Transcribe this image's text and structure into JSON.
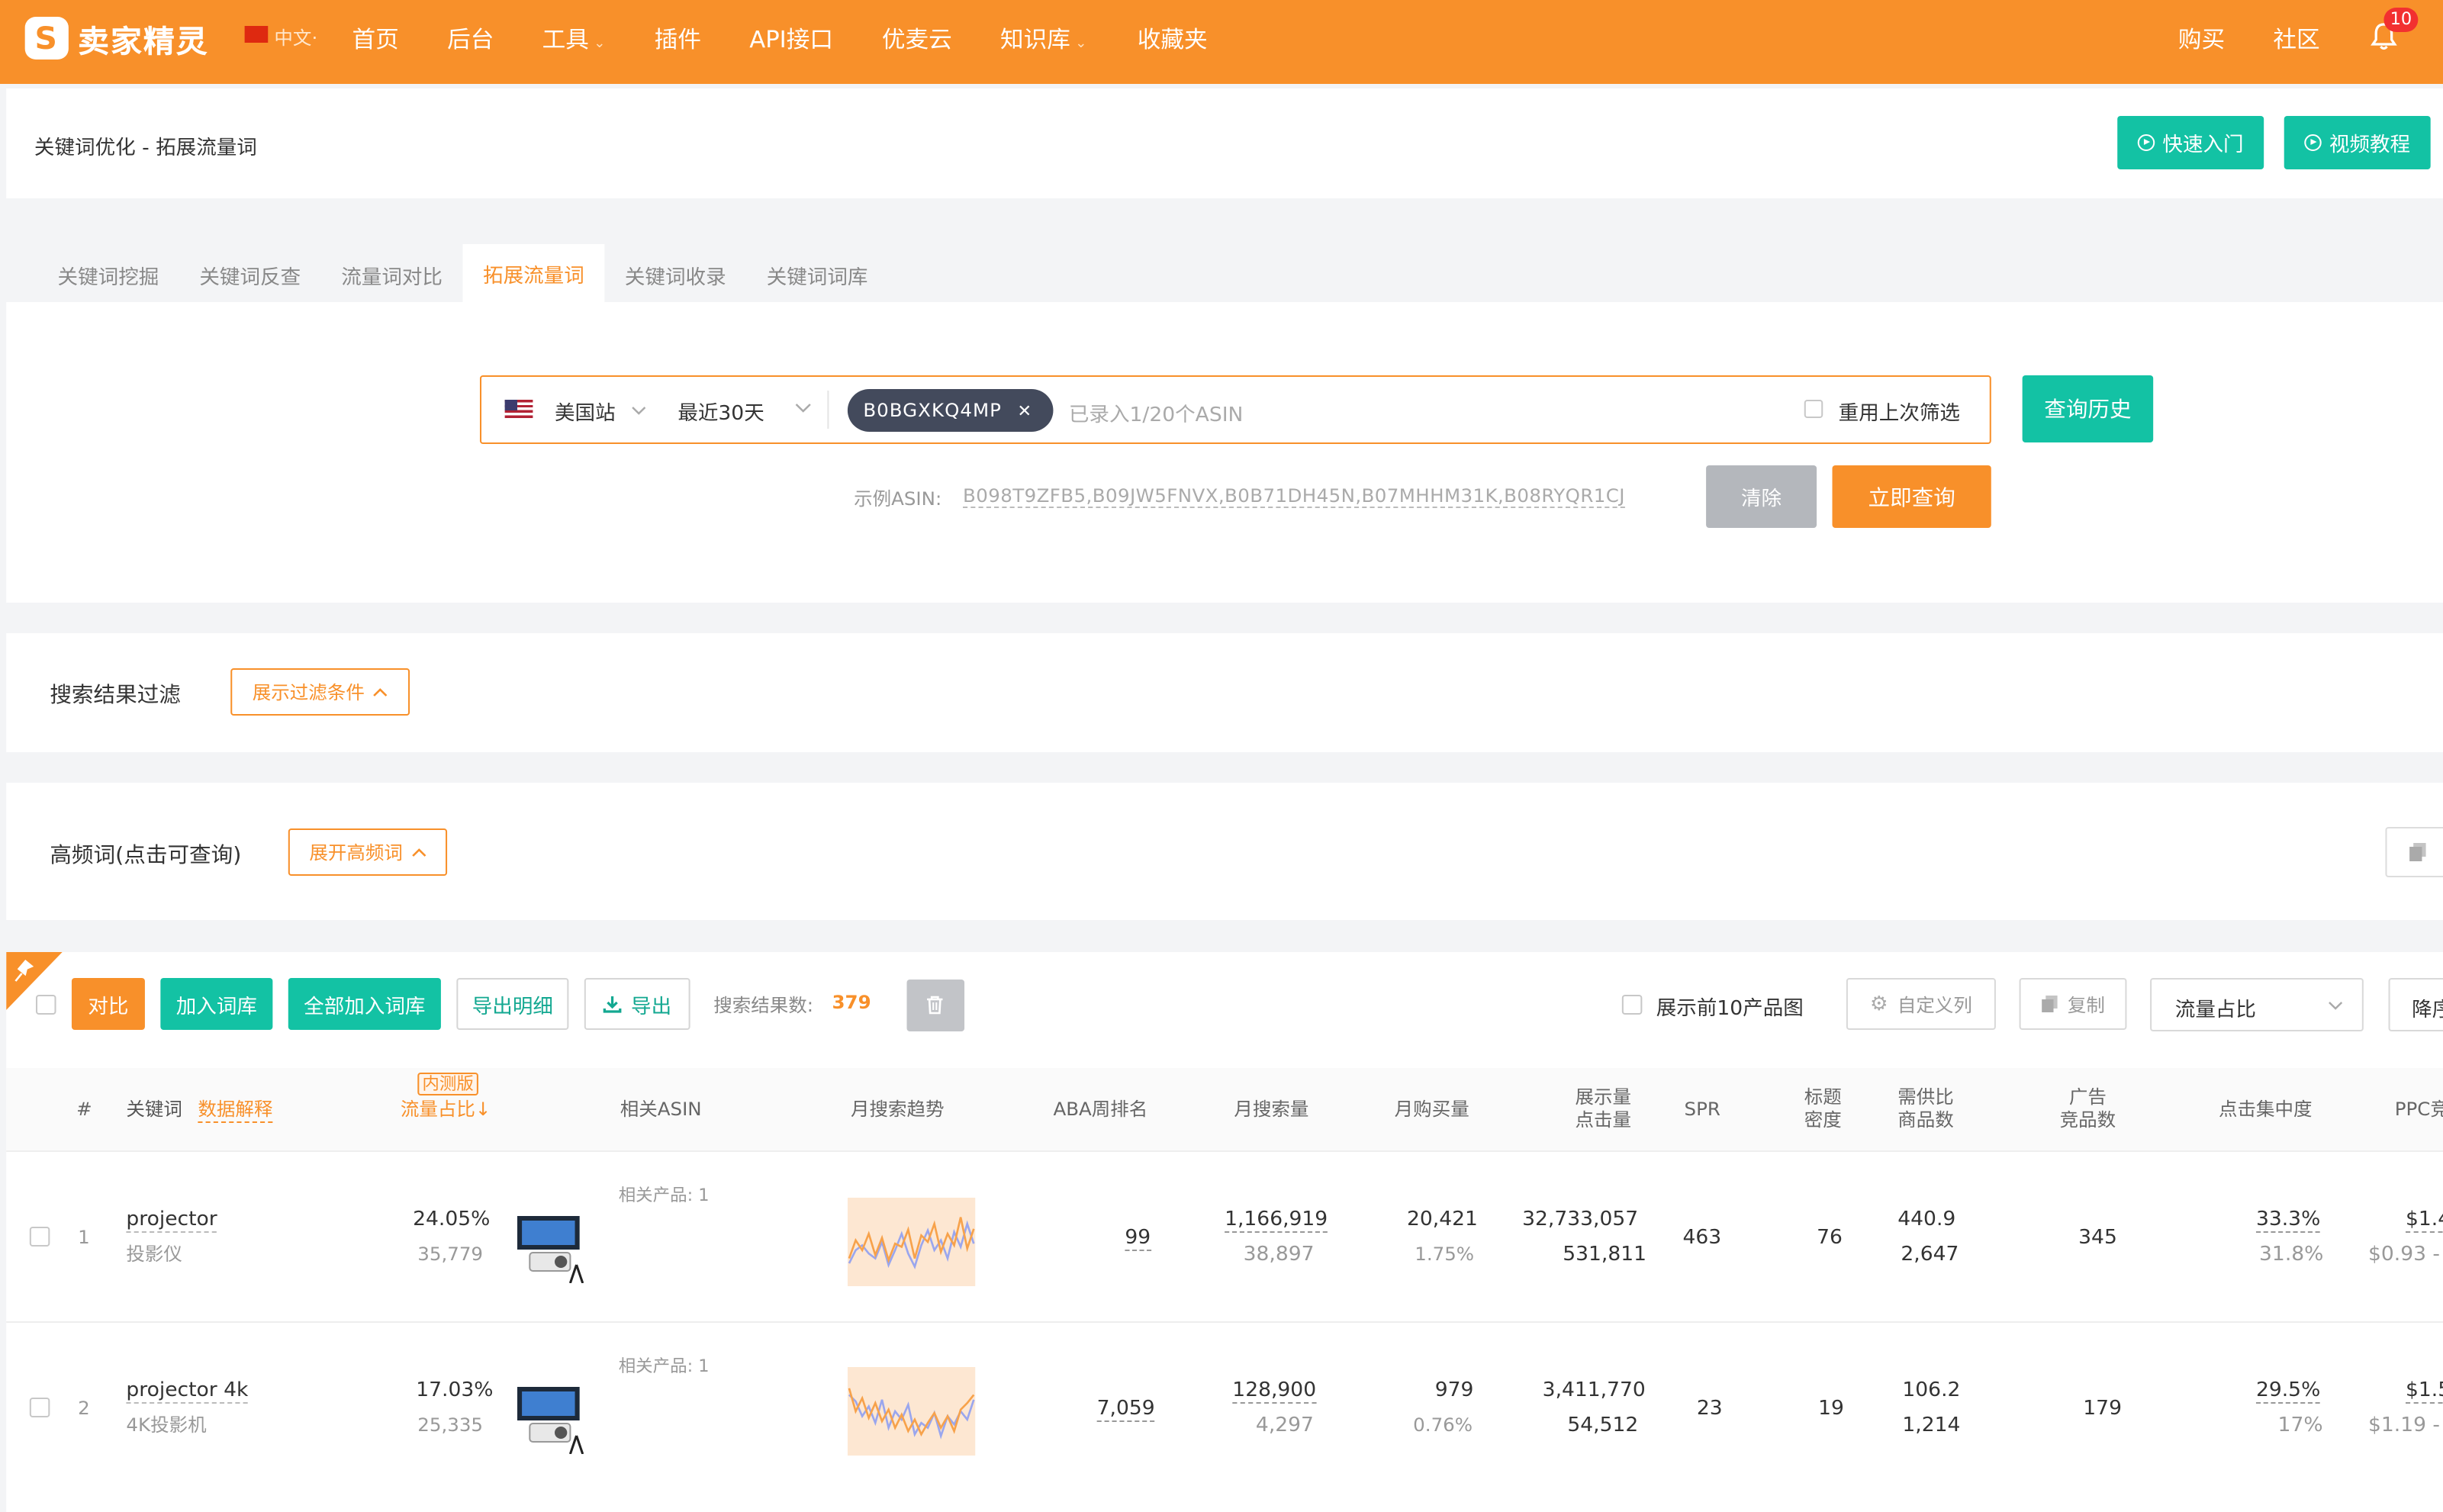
{
  "brand": {
    "logo_mark": "S",
    "name": "卖家精灵",
    "lang": "中文",
    "lang_caret": "·",
    "accent": "#f8902a",
    "teal": "#13c2a4"
  },
  "nav": {
    "items": [
      {
        "label": "首页",
        "caret": ""
      },
      {
        "label": "后台",
        "caret": ""
      },
      {
        "label": "工具",
        "caret": "⌄"
      },
      {
        "label": "插件",
        "caret": ""
      },
      {
        "label": "API接口",
        "caret": ""
      },
      {
        "label": "优麦云",
        "caret": ""
      },
      {
        "label": "知识库",
        "caret": "⌄"
      },
      {
        "label": "收藏夹",
        "caret": ""
      }
    ],
    "right": [
      "购买",
      "社区"
    ],
    "notifications": "10"
  },
  "header": {
    "title": "关键词优化 - 拓展流量词",
    "quick_start": "快速入门",
    "video_tutorial": "视频教程"
  },
  "tabs": [
    {
      "label": "关键词挖掘"
    },
    {
      "label": "关键词反查"
    },
    {
      "label": "流量词对比"
    },
    {
      "label": "拓展流量词"
    },
    {
      "label": "关键词收录"
    },
    {
      "label": "关键词词库"
    }
  ],
  "search": {
    "marketplace": "美国站",
    "period": "最近30天",
    "asin_chip": "B0BGXKQ4MP",
    "placeholder": "已录入1/20个ASIN",
    "reuse_filter": "重用上次筛选",
    "history_button": "查询历史",
    "example_label": "示例ASIN:",
    "example_value": "B098T9ZFB5,B09JW5FNVX,B0B71DH45N,B07MHHM31K,B08RYQR1CJ",
    "clear_button": "清除",
    "query_button": "立即查询"
  },
  "filters": {
    "result_filter_label": "搜索结果过滤",
    "show_filter_button": "展示过滤条件",
    "high_freq_label": "高频词(点击可查询)",
    "show_high_freq_button": "展开高频词"
  },
  "toolbar": {
    "compare": "对比",
    "add_to_lib": "加入词库",
    "add_all_to_lib": "全部加入词库",
    "export_detail": "导出明细",
    "export": "导出",
    "result_count_label": "搜索结果数:",
    "result_count": "379",
    "show_top10": "展示前10产品图",
    "custom_columns": "自定义列",
    "copy": "复制",
    "sort_select": "流量占比",
    "order_select": "降序"
  },
  "table": {
    "headers": {
      "index": "#",
      "keyword": "关键词",
      "data_explain": "数据解释",
      "beta_badge": "内测版",
      "traffic_share": "流量占比↓",
      "related_asin": "相关ASIN",
      "trend": "月搜索趋势",
      "aba_rank": "ABA周排名",
      "monthly_search": "月搜索量",
      "monthly_purchase": "月购买量",
      "impressions_1": "展示量",
      "impressions_2": "点击量",
      "spr": "SPR",
      "title_density_1": "标题",
      "title_density_2": "密度",
      "supply_demand_1": "需供比",
      "supply_demand_2": "商品数",
      "ad_products_1": "广告",
      "ad_products_2": "竞品数",
      "click_concentration": "点击集中度",
      "ppc": "PPC竞"
    },
    "rows": [
      {
        "index": "1",
        "keyword": "projector",
        "translation": "投影仪",
        "share": "24.05%",
        "share_sub": "35,779",
        "related": "相关产品: 1",
        "trend_orange": [
          30,
          52,
          40,
          60,
          34,
          55,
          28,
          48,
          44,
          65,
          30,
          58,
          50,
          72,
          38,
          60,
          46,
          80,
          42,
          66
        ],
        "trend_blue": [
          24,
          40,
          46,
          36,
          30,
          50,
          22,
          40,
          60,
          36,
          20,
          46,
          64,
          40,
          52,
          30,
          62,
          44,
          72,
          48
        ],
        "aba": "99",
        "monthly_search": "1,166,919",
        "monthly_search_sub": "38,897",
        "monthly_purchase": "20,421",
        "monthly_purchase_sub": "1.75%",
        "impressions": "32,733,057",
        "clicks": "531,811",
        "spr": "463",
        "title_density": "76",
        "supply_demand": "440.9",
        "products": "2,647",
        "ad_products": "345",
        "click_conc": "33.3%",
        "click_conc_sub": "31.8%",
        "ppc": "$1.4",
        "ppc_sub": "$0.93 -"
      },
      {
        "index": "2",
        "keyword": "projector 4k",
        "translation": "4K投影机",
        "share": "17.03%",
        "share_sub": "25,335",
        "related": "相关产品: 1",
        "trend_orange": [
          78,
          50,
          66,
          42,
          60,
          38,
          52,
          30,
          46,
          26,
          40,
          22,
          36,
          48,
          30,
          44,
          26,
          52,
          60,
          70
        ],
        "trend_blue": [
          70,
          62,
          44,
          56,
          36,
          64,
          30,
          50,
          40,
          58,
          22,
          36,
          30,
          48,
          20,
          44,
          34,
          50,
          40,
          64
        ],
        "aba": "7,059",
        "monthly_search": "128,900",
        "monthly_search_sub": "4,297",
        "monthly_purchase": "979",
        "monthly_purchase_sub": "0.76%",
        "impressions": "3,411,770",
        "clicks": "54,512",
        "spr": "23",
        "title_density": "19",
        "supply_demand": "106.2",
        "products": "1,214",
        "ad_products": "179",
        "click_conc": "29.5%",
        "click_conc_sub": "17%",
        "ppc": "$1.5",
        "ppc_sub": "$1.19 -"
      }
    ]
  }
}
